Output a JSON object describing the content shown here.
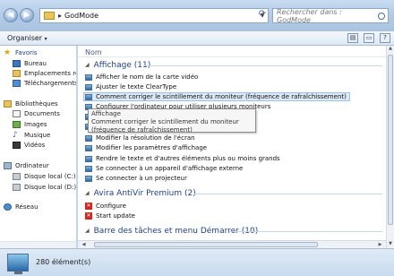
{
  "address": {
    "path": "GodMode",
    "separator": "▸"
  },
  "search": {
    "placeholder": "Rechercher dans : GodMode"
  },
  "toolbar": {
    "organize": "Organiser",
    "organize_arrow": "▾"
  },
  "nav": {
    "favorites": "Favoris",
    "fav_items": [
      "Bureau",
      "Emplacements récents",
      "Téléchargements"
    ],
    "libraries": "Bibliothèques",
    "lib_items": [
      "Documents",
      "Images",
      "Musique",
      "Vidéos"
    ],
    "computer": "Ordinateur",
    "comp_items": [
      "Disque local (C:)",
      "Disque local (D:)"
    ],
    "network": "Réseau"
  },
  "main": {
    "column_header": "Nom",
    "groups": [
      {
        "title": "Affichage (11)",
        "items": [
          "Afficher le nom de la carte vidéo",
          "Ajuster le texte ClearType",
          "Comment corriger le scintillement du moniteur (fréquence de rafraîchissement)",
          "Configurer l'ordinateur pour utiliser plusieurs moniteurs",
          "",
          "",
          "Modifier la résolution de l'écran",
          "Modifier les paramètres d'affichage",
          "Rendre le texte et d'autres éléments plus ou moins grands",
          "Se connecter à un appareil d'affichage externe",
          "Se connecter à un projecteur"
        ]
      },
      {
        "title": "Avira AntiVir Premium (2)",
        "items": [
          "Configure",
          "Start update"
        ]
      },
      {
        "title": "Barre des tâches et menu Démarrer (10)",
        "items": []
      }
    ],
    "chevron": "◢"
  },
  "tooltip": {
    "title": "Affichage",
    "body": "Comment corriger le scintillement du moniteur (fréquence de rafraîchissement)"
  },
  "status": {
    "count": "280 élément(s)"
  },
  "colors": {
    "group_heading": "#1f3f8f",
    "selection": "#dbe9f9",
    "avira": "#d9241c"
  },
  "icons": {
    "back": "back-arrow-icon",
    "forward": "forward-arrow-icon",
    "folder": "folder-icon",
    "refresh": "refresh-icon",
    "search": "search-icon",
    "monitor": "monitor-icon",
    "avira": "avira-icon"
  }
}
